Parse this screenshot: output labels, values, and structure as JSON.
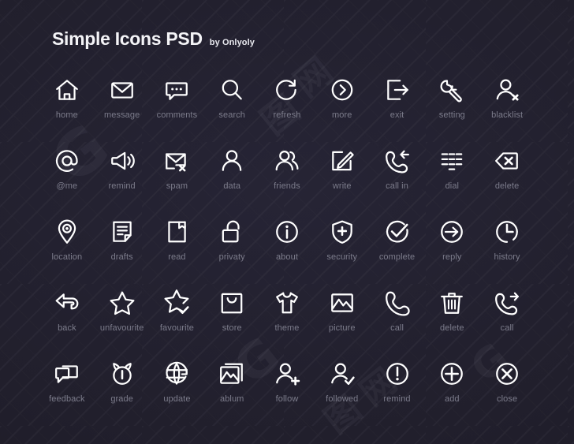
{
  "header": {
    "title": "Simple Icons PSD",
    "byline": "by Onlyoly"
  },
  "theme": {
    "background": "#211f2c",
    "icon_color": "#ffffff",
    "label_color": "#7c7c8b",
    "title_color": "#f4f4f7"
  },
  "watermark": {
    "marks": [
      "G",
      "图",
      "网",
      "G",
      "图",
      "网",
      "G"
    ]
  },
  "icons": [
    {
      "id": "home",
      "label": "home",
      "icon": "home-icon"
    },
    {
      "id": "message",
      "label": "message",
      "icon": "envelope-icon"
    },
    {
      "id": "comments",
      "label": "comments",
      "icon": "comment-bubble-icon"
    },
    {
      "id": "search",
      "label": "search",
      "icon": "search-icon"
    },
    {
      "id": "refresh",
      "label": "refresh",
      "icon": "refresh-icon"
    },
    {
      "id": "more",
      "label": "more",
      "icon": "chevron-right-circle-icon"
    },
    {
      "id": "exit",
      "label": "exit",
      "icon": "exit-arrow-icon"
    },
    {
      "id": "setting",
      "label": "setting",
      "icon": "wrench-icon"
    },
    {
      "id": "blacklist",
      "label": "blacklist",
      "icon": "person-x-icon"
    },
    {
      "id": "atme",
      "label": "@me",
      "icon": "at-sign-icon"
    },
    {
      "id": "remind-horn",
      "label": "remind",
      "icon": "megaphone-icon"
    },
    {
      "id": "spam",
      "label": "spam",
      "icon": "envelope-x-icon"
    },
    {
      "id": "data",
      "label": "data",
      "icon": "person-icon"
    },
    {
      "id": "friends",
      "label": "friends",
      "icon": "two-people-icon"
    },
    {
      "id": "write",
      "label": "write",
      "icon": "pencil-square-icon"
    },
    {
      "id": "call-in",
      "label": "call in",
      "icon": "phone-incoming-icon"
    },
    {
      "id": "dial",
      "label": "dial",
      "icon": "dialpad-icon"
    },
    {
      "id": "delete-back",
      "label": "delete",
      "icon": "backspace-x-icon"
    },
    {
      "id": "location",
      "label": "location",
      "icon": "map-pin-icon"
    },
    {
      "id": "drafts",
      "label": "drafts",
      "icon": "document-lines-icon"
    },
    {
      "id": "read",
      "label": "read",
      "icon": "book-bookmark-icon"
    },
    {
      "id": "privaty",
      "label": "privaty",
      "icon": "unlocked-padlock-icon"
    },
    {
      "id": "about",
      "label": "about",
      "icon": "info-circle-icon"
    },
    {
      "id": "security",
      "label": "security",
      "icon": "shield-plus-icon"
    },
    {
      "id": "complete",
      "label": "complete",
      "icon": "check-circle-icon"
    },
    {
      "id": "reply",
      "label": "reply",
      "icon": "arrow-right-circle-icon"
    },
    {
      "id": "history",
      "label": "history",
      "icon": "clock-icon"
    },
    {
      "id": "back",
      "label": "back",
      "icon": "arrow-left-icon"
    },
    {
      "id": "unfavourite",
      "label": "unfavourite",
      "icon": "star-icon"
    },
    {
      "id": "favourite",
      "label": "favourite",
      "icon": "star-check-icon"
    },
    {
      "id": "store",
      "label": "store",
      "icon": "shopping-bag-icon"
    },
    {
      "id": "theme",
      "label": "theme",
      "icon": "tshirt-icon"
    },
    {
      "id": "picture",
      "label": "picture",
      "icon": "picture-icon"
    },
    {
      "id": "call",
      "label": "call",
      "icon": "phone-icon"
    },
    {
      "id": "delete-bin",
      "label": "delete",
      "icon": "trash-icon"
    },
    {
      "id": "call-out",
      "label": "call",
      "icon": "phone-outgoing-icon"
    },
    {
      "id": "feedback",
      "label": "feedback",
      "icon": "chat-bubbles-icon"
    },
    {
      "id": "grade",
      "label": "grade",
      "icon": "timer-icon"
    },
    {
      "id": "update",
      "label": "update",
      "icon": "globe-refresh-icon"
    },
    {
      "id": "ablum",
      "label": "ablum",
      "icon": "album-stack-icon"
    },
    {
      "id": "follow",
      "label": "follow",
      "icon": "person-plus-icon"
    },
    {
      "id": "followed",
      "label": "followed",
      "icon": "person-check-icon"
    },
    {
      "id": "remind",
      "label": "remind",
      "icon": "exclamation-circle-icon"
    },
    {
      "id": "add",
      "label": "add",
      "icon": "plus-circle-icon"
    },
    {
      "id": "close",
      "label": "close",
      "icon": "x-circle-icon"
    }
  ]
}
